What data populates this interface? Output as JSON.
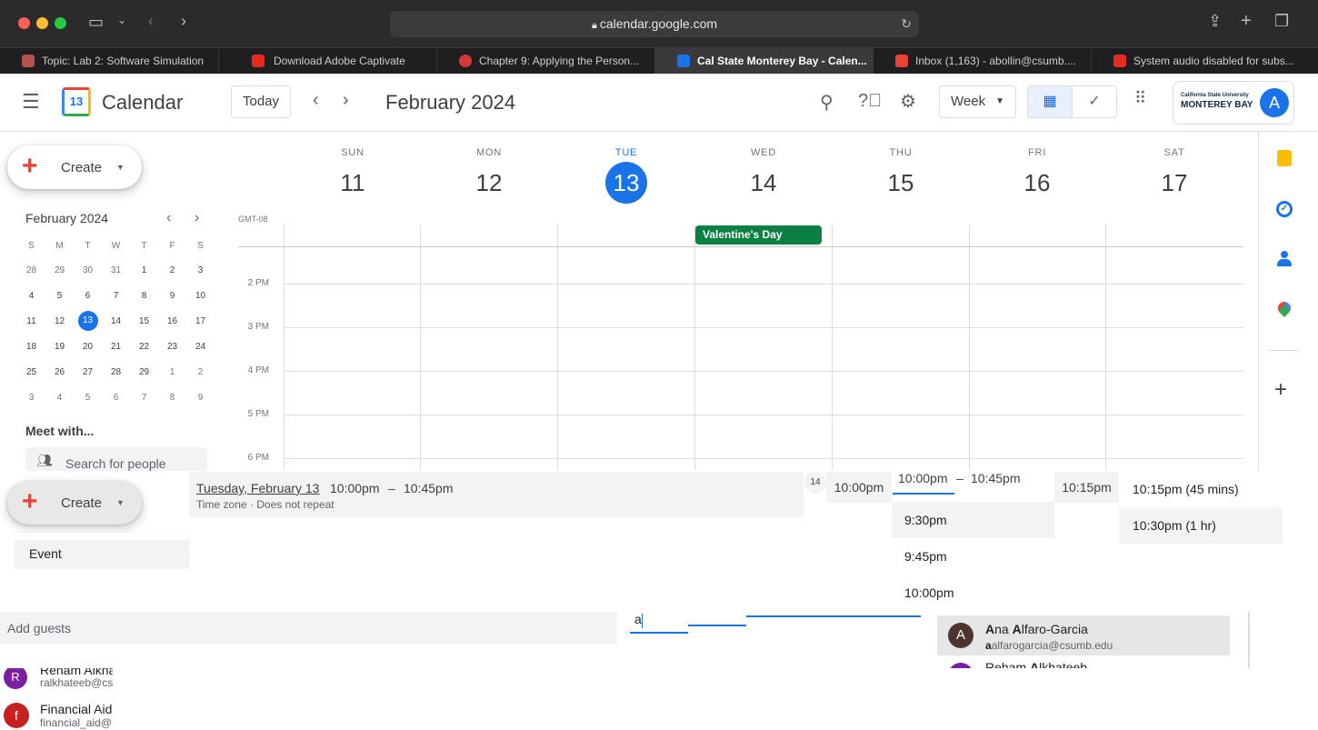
{
  "browser": {
    "url": "calendar.google.com",
    "tabs": [
      {
        "label": "Topic: Lab 2: Software Simulation",
        "icon": "shield-favicon",
        "color": "#b5524c"
      },
      {
        "label": "Download Adobe Captivate",
        "icon": "adobe-favicon",
        "color": "#e62b1e"
      },
      {
        "label": "Chapter 9: Applying the Person...",
        "icon": "o-favicon",
        "color": "#d4393b"
      },
      {
        "label": "Cal State Monterey Bay - Calen...",
        "icon": "calendar-favicon",
        "color": "#1a73e8"
      },
      {
        "label": "Inbox (1,163) - abollin@csumb....",
        "icon": "gmail-favicon",
        "color": "#ea4335"
      },
      {
        "label": "System audio disabled for subs...",
        "icon": "adobe-favicon",
        "color": "#e62b1e"
      }
    ]
  },
  "header": {
    "app_name": "Calendar",
    "logo_day": "13",
    "today_label": "Today",
    "current_period": "February 2024",
    "view_select": "Week",
    "org_logo_top": "California State University",
    "org_logo_bottom": "MONTEREY BAY",
    "avatar_letter": "A"
  },
  "sidebar": {
    "create_label": "Create",
    "mini_title": "February 2024",
    "weekday_initials": [
      "S",
      "M",
      "T",
      "W",
      "T",
      "F",
      "S"
    ],
    "weeks": [
      [
        "28",
        "29",
        "30",
        "31",
        "1",
        "2",
        "3"
      ],
      [
        "4",
        "5",
        "6",
        "7",
        "8",
        "9",
        "10"
      ],
      [
        "11",
        "12",
        "13",
        "14",
        "15",
        "16",
        "17"
      ],
      [
        "18",
        "19",
        "20",
        "21",
        "22",
        "23",
        "24"
      ],
      [
        "25",
        "26",
        "27",
        "28",
        "29",
        "1",
        "2"
      ],
      [
        "3",
        "4",
        "5",
        "6",
        "7",
        "8",
        "9"
      ]
    ],
    "meet_with": "Meet with...",
    "search_people_placeholder": "Search for people"
  },
  "week": {
    "timezone": "GMT-08",
    "days": [
      {
        "name": "SUN",
        "num": "11"
      },
      {
        "name": "MON",
        "num": "12"
      },
      {
        "name": "TUE",
        "num": "13",
        "today": true
      },
      {
        "name": "WED",
        "num": "14"
      },
      {
        "name": "THU",
        "num": "15"
      },
      {
        "name": "FRI",
        "num": "16"
      },
      {
        "name": "SAT",
        "num": "17"
      }
    ],
    "hours": [
      "2 PM",
      "3 PM",
      "4 PM",
      "5 PM",
      "6 PM"
    ],
    "all_day_event": {
      "title": "Valentine's Day",
      "color": "#0b8043"
    }
  },
  "overlay": {
    "create_label": "Create",
    "menu_event": "Event",
    "event_date": "Tuesday, February 13",
    "event_start": "10:00pm",
    "event_dash": "–",
    "event_end": "10:45pm",
    "event_sub": "Time zone · Does not repeat",
    "mini_day": "14",
    "chip_time_1": "10:00pm",
    "edit_start": "10:00pm",
    "edit_dash": "–",
    "edit_end": "10:45pm",
    "chip_time_2": "10:15pm",
    "start_options": [
      "9:30pm",
      "9:45pm",
      "10:00pm"
    ],
    "end_options": [
      "10:15pm (45 mins)",
      "10:30pm (1 hr)"
    ],
    "add_guests_placeholder": "Add guests",
    "guest_input_value": "a",
    "guest_suggestions": [
      {
        "letter": "A",
        "name_bold": "A",
        "name_rest": "na ",
        "name_bold2": "A",
        "name_rest2": "lfaro-Garcia",
        "email_bold": "a",
        "email_rest": "alfarogarcia@csumb.edu",
        "color": "#4e342e"
      },
      {
        "letter": "",
        "name_bold": "",
        "name_rest": "Reham ",
        "name_bold2": "A",
        "name_rest2": "lkhateeb",
        "email_bold": "",
        "email_rest": "",
        "color": "#7b1fa2"
      }
    ],
    "left_suggestions": [
      {
        "letter": "R",
        "name": "Reham Alkha",
        "email": "ralkhateeb@cs",
        "color": "#7b1fa2"
      },
      {
        "letter": "f",
        "name": "Financial Aid",
        "email": "financial_aid@",
        "color": "#c5221f"
      }
    ]
  }
}
